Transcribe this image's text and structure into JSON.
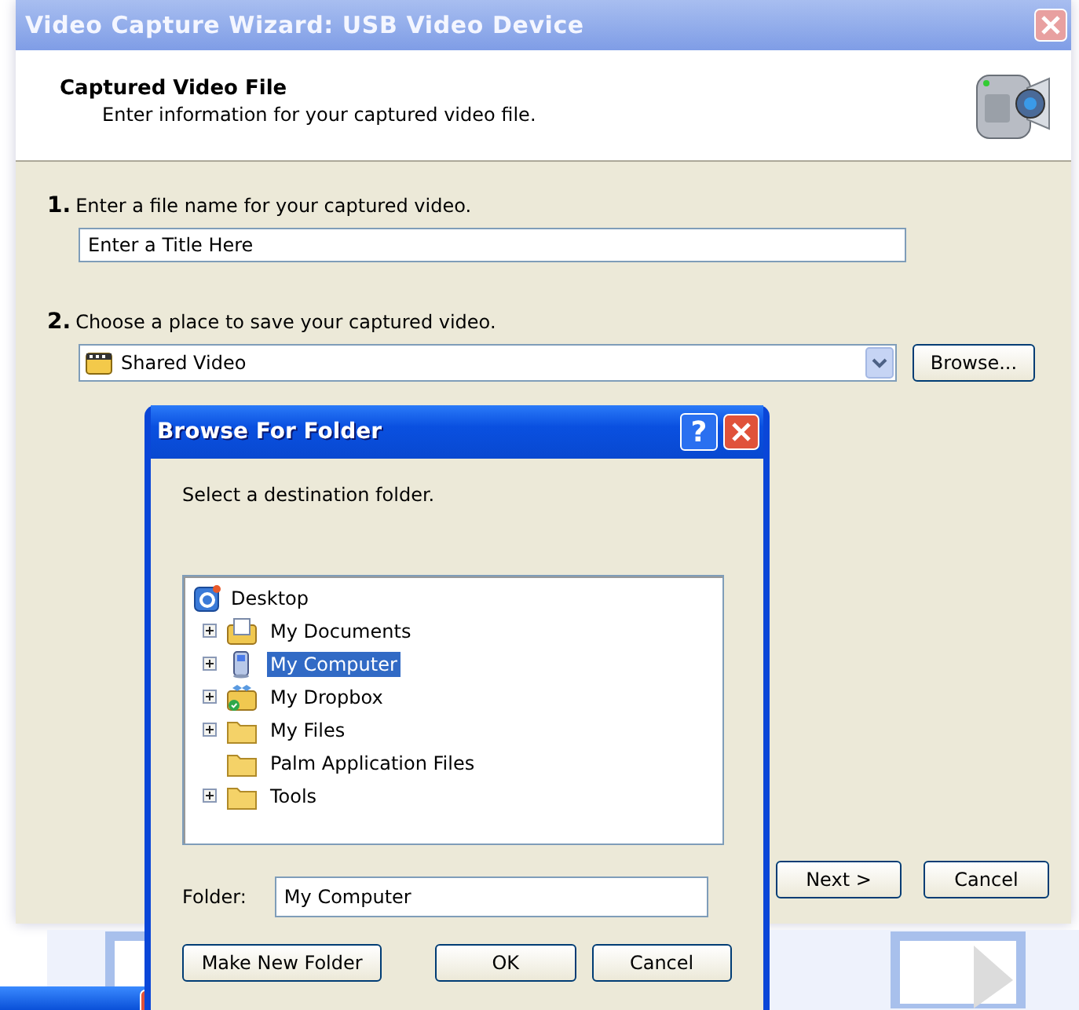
{
  "window": {
    "title": "Video Capture Wizard: USB Video Device"
  },
  "header": {
    "title": "Captured Video File",
    "subtitle": "Enter information for your captured video file."
  },
  "steps": [
    {
      "number": "1.",
      "label": "Enter a file name for your captured video.",
      "kind": "text",
      "value": "Enter a Title Here"
    },
    {
      "number": "2.",
      "label": "Choose a place to save your captured video.",
      "kind": "combo",
      "value": "Shared Video",
      "button": "Browse..."
    }
  ],
  "buttons": [
    "Next >",
    "Cancel"
  ],
  "dialog": {
    "title": "Browse For Folder",
    "help": "?",
    "prompt": "Select a destination folder.",
    "tree": {
      "label": "Desktop",
      "children": [
        {
          "label": "My Documents",
          "kind": "documents",
          "expandable": true,
          "selected": false
        },
        {
          "label": "My Computer",
          "kind": "computer",
          "expandable": true,
          "selected": true
        },
        {
          "label": "My Dropbox",
          "kind": "dropbox",
          "expandable": true,
          "selected": false
        },
        {
          "label": "My Files",
          "kind": "folder",
          "expandable": true,
          "selected": false
        },
        {
          "label": "Palm Application Files",
          "kind": "folder",
          "expandable": false,
          "selected": false
        },
        {
          "label": "Tools",
          "kind": "folder",
          "expandable": true,
          "selected": false
        }
      ]
    },
    "folder_label": "Folder:",
    "folder_value": "My Computer",
    "buttons": [
      "Make New Folder",
      "OK",
      "Cancel"
    ]
  }
}
